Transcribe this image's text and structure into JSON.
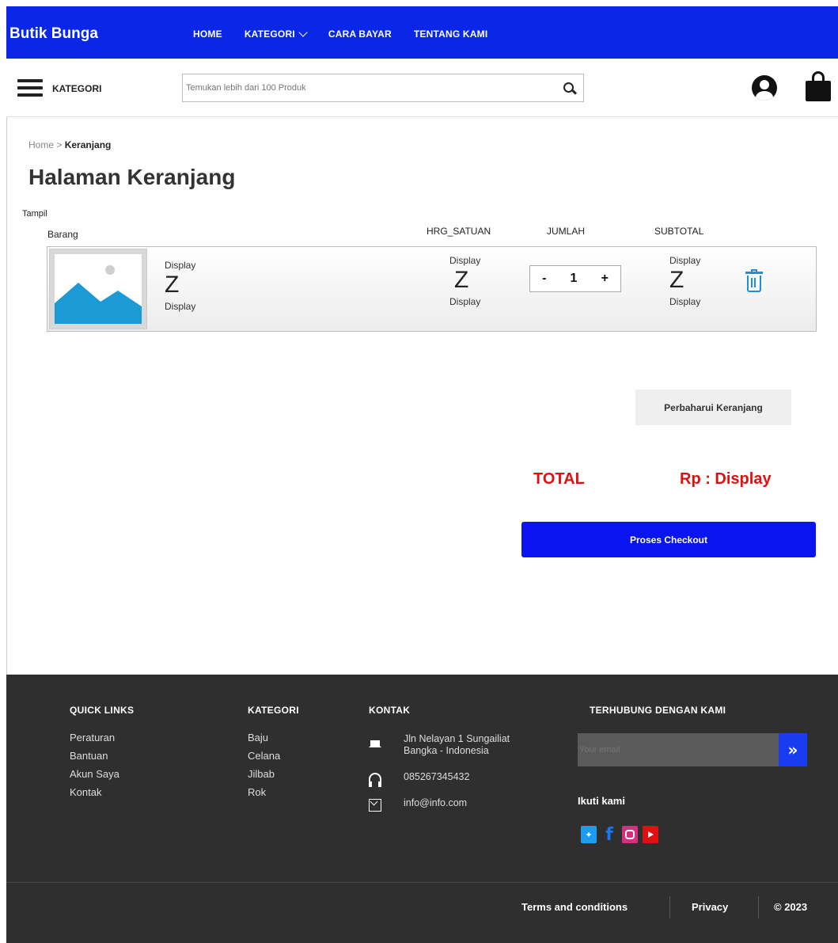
{
  "nav": {
    "brand": "Butik Bunga",
    "links": [
      "HOME",
      "KATEGORI",
      "CARA BAYAR",
      "TENTANG KAMI"
    ]
  },
  "subbar": {
    "kategori_label": "KATEGORI",
    "search_placeholder": "Temukan lebih dari 100 Produk"
  },
  "breadcrumb": {
    "home": "Home",
    "sep": " > ",
    "current": "Keranjang"
  },
  "page_title": "Halaman Keranjang",
  "table": {
    "tampil": "Tampil",
    "barang": "Barang",
    "headers": {
      "price": "HRG_SATUAN",
      "qty": "JUMLAH",
      "subtotal": "SUBTOTAL"
    }
  },
  "cart_item": {
    "name_top": "Display",
    "name_z": "Z",
    "name_bottom": "Display",
    "price_top": "Display",
    "price_z": "Z",
    "price_bottom": "Display",
    "qty_minus": "-",
    "qty_value": "1",
    "qty_plus": "+",
    "sub_top": "Display",
    "sub_z": "Z",
    "sub_bottom": "Display"
  },
  "update_button": "Perbaharui Keranjang",
  "total_label": "TOTAL",
  "total_value": "Rp : Display",
  "checkout_button": "Proses Checkout",
  "footer": {
    "quick_links_title": "QUICK LINKS",
    "quick_links": [
      "Peraturan",
      "Bantuan",
      "Akun Saya",
      "Kontak"
    ],
    "kategori_title": "KATEGORI",
    "kategori": [
      "Baju",
      "Celana",
      "Jilbab",
      "Rok"
    ],
    "kontak_title": "KONTAK",
    "address_line1": "Jln Nelayan 1 Sungailiat",
    "address_line2": "Bangka - Indonesia",
    "phone": "085267345432",
    "email": "info@info.com",
    "connect_title": "TERHUBUNG DENGAN KAMI",
    "email_placeholder": "Your email",
    "follow_label": "Ikuti kami",
    "terms": "Terms and conditions",
    "privacy": "Privacy",
    "copyright": "© 2023"
  },
  "colors": {
    "nav_bg": "#0a27e8",
    "checkout_bg": "#0a14f0",
    "total_red": "#e01010",
    "footer_bg": "#2f2f2f",
    "trash_blue": "#1e90d6"
  },
  "icons": {
    "menu": "hamburger-icon",
    "search": "search-icon",
    "user": "user-icon",
    "cart": "shopping-bag-icon",
    "delete": "trash-icon",
    "address": "home-icon",
    "phone": "headphone-icon",
    "mail": "mail-icon",
    "submit": "double-chevron-right-icon"
  }
}
